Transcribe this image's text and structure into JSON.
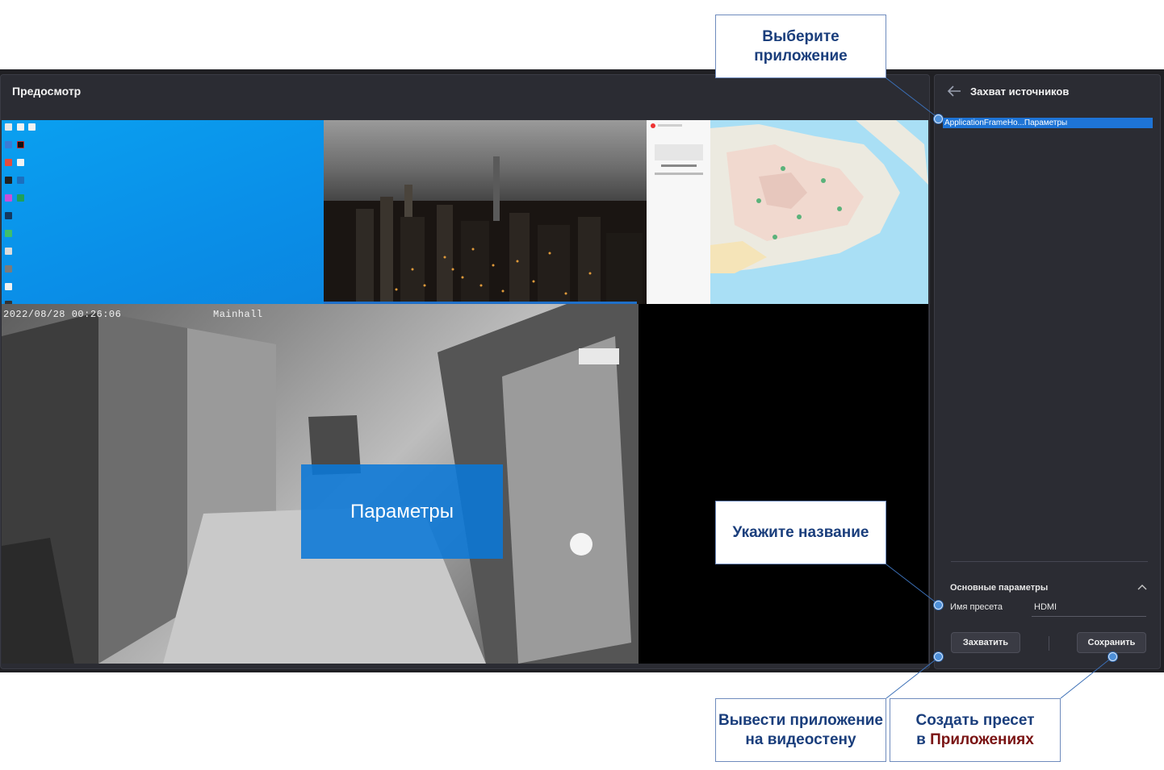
{
  "preview": {
    "title": "Предосмотр",
    "camera_timestamp": "2022/08/28 00:26:06",
    "camera_name": "Mainhall",
    "overlay_label": "Параметры"
  },
  "capture": {
    "title": "Захват источников",
    "source_item": "ApplicationFrameHo...Параметры",
    "section_title": "Основные параметры",
    "preset_label": "Имя пресета",
    "preset_value": "HDMI",
    "capture_button": "Захватить",
    "save_button": "Сохранить"
  },
  "callouts": {
    "select_app_1": "Выберите",
    "select_app_2": "приложение",
    "enter_name": "Укажите название",
    "output_1": "Вывести приложение",
    "output_2": "на видеостену",
    "create_1": "Создать пресет",
    "create_2": "в",
    "create_3": "Приложениях"
  },
  "colors": {
    "accent": "#1e74d6",
    "callout_text": "#1a3e7c",
    "callout_highlight": "#7a1414"
  },
  "icons": [
    "back-arrow-icon",
    "chevron-up-icon"
  ]
}
